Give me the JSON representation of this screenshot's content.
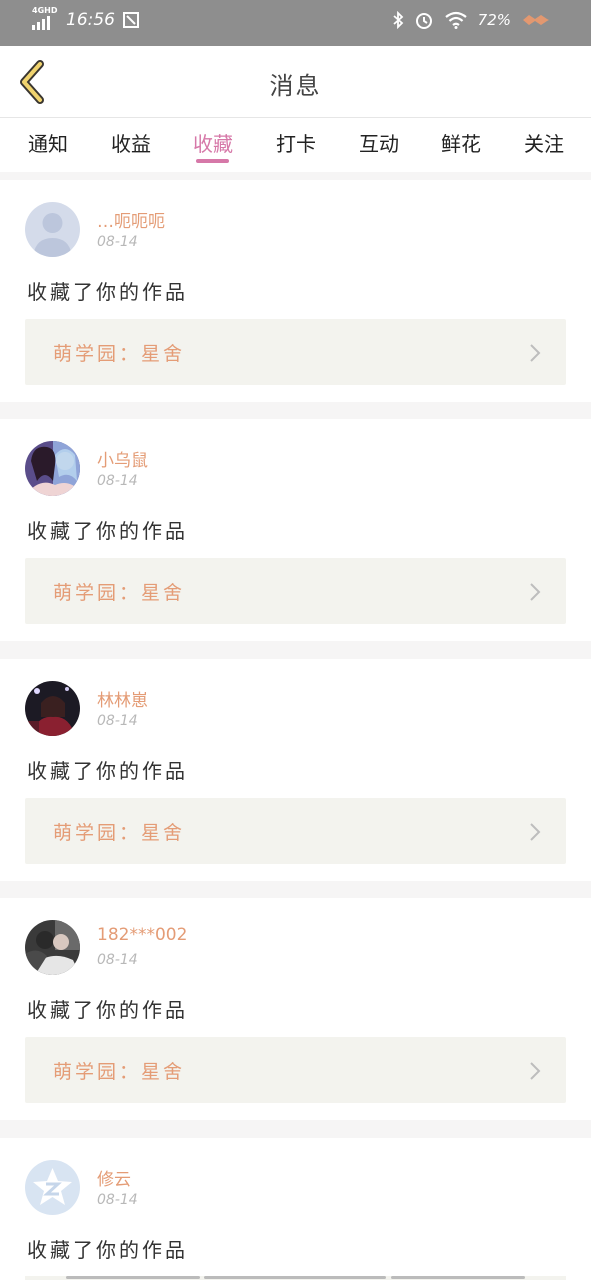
{
  "status_bar": {
    "network": "4GHD",
    "time": "16:56",
    "battery": "72%"
  },
  "header": {
    "title": "消息"
  },
  "tabs": [
    {
      "label": "通知",
      "active": false
    },
    {
      "label": "收益",
      "active": false
    },
    {
      "label": "收藏",
      "active": true
    },
    {
      "label": "打卡",
      "active": false
    },
    {
      "label": "互动",
      "active": false
    },
    {
      "label": "鲜花",
      "active": false
    },
    {
      "label": "关注",
      "active": false
    }
  ],
  "notifications": [
    {
      "username": "…呃呃呃",
      "date": "08-14",
      "action": "收藏了你的作品",
      "work": "萌学园：星舍",
      "avatar": "default-avatar-icon"
    },
    {
      "username": "小乌鼠",
      "date": "08-14",
      "action": "收藏了你的作品",
      "work": "萌学园：星舍",
      "avatar": "photo-avatar"
    },
    {
      "username": "林林崽",
      "date": "08-14",
      "action": "收藏了你的作品",
      "work": "萌学园：星舍",
      "avatar": "photo-avatar"
    },
    {
      "username": "182***002",
      "date": "08-14",
      "action": "收藏了你的作品",
      "work": "萌学园：星舍",
      "avatar": "photo-avatar"
    },
    {
      "username": "修云",
      "date": "08-14",
      "action": "收藏了你的作品",
      "work": "",
      "avatar": "qq-default-avatar-icon"
    }
  ],
  "colors": {
    "accent": "#d678a8",
    "username": "#e49c76",
    "status_bar": "#8e8e8e",
    "work_bg": "#f3f3ee"
  }
}
